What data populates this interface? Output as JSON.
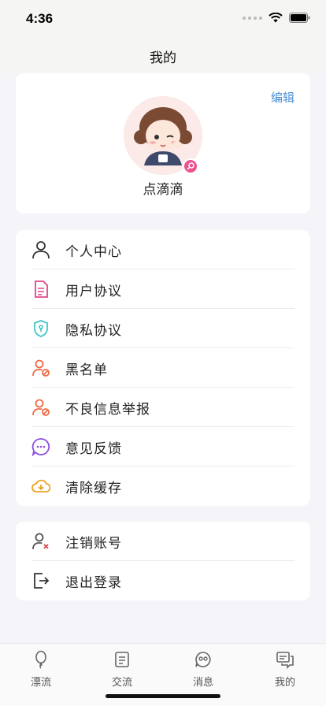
{
  "status": {
    "time": "4:36"
  },
  "nav": {
    "title": "我的"
  },
  "profile": {
    "edit_label": "编辑",
    "username": "点滴滴"
  },
  "menu": {
    "group1": [
      {
        "label": "个人中心",
        "icon": "user-icon",
        "color": "#333333"
      },
      {
        "label": "用户协议",
        "icon": "document-icon",
        "color": "#e0458a"
      },
      {
        "label": "隐私协议",
        "icon": "shield-icon",
        "color": "#3fc6c6"
      },
      {
        "label": "黑名单",
        "icon": "user-block-icon",
        "color": "#f06a45"
      },
      {
        "label": "不良信息举报",
        "icon": "user-report-icon",
        "color": "#f06a45"
      },
      {
        "label": "意见反馈",
        "icon": "chat-bubble-icon",
        "color": "#8a4fe0"
      },
      {
        "label": "清除缓存",
        "icon": "cloud-download-icon",
        "color": "#f0a020"
      }
    ],
    "group2": [
      {
        "label": "注销账号",
        "icon": "user-remove-icon",
        "color": "#e04848"
      },
      {
        "label": "退出登录",
        "icon": "logout-icon",
        "color": "#333333"
      }
    ]
  },
  "tabs": [
    {
      "label": "漂流",
      "icon": "balloon-icon"
    },
    {
      "label": "交流",
      "icon": "list-icon"
    },
    {
      "label": "消息",
      "icon": "message-face-icon"
    },
    {
      "label": "我的",
      "icon": "chat-icon"
    }
  ],
  "colors": {
    "accent": "#4a8fd8",
    "background": "#f5f5f9"
  }
}
